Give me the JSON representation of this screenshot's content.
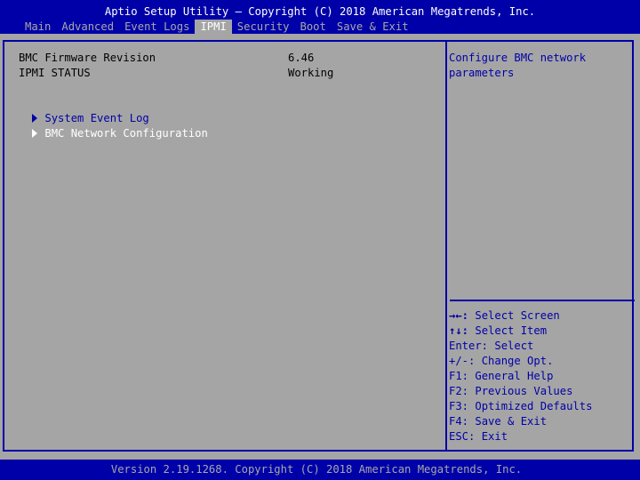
{
  "header": {
    "title": "Aptio Setup Utility – Copyright (C) 2018 American Megatrends, Inc.",
    "tabs": [
      {
        "label": "Main"
      },
      {
        "label": "Advanced"
      },
      {
        "label": "Event Logs"
      },
      {
        "label": "IPMI"
      },
      {
        "label": "Security"
      },
      {
        "label": "Boot"
      },
      {
        "label": "Save & Exit"
      }
    ],
    "active_tab": "IPMI"
  },
  "main": {
    "fields": [
      {
        "label": "BMC Firmware Revision",
        "value": "6.46"
      },
      {
        "label": "IPMI STATUS",
        "value": "Working"
      }
    ],
    "submenus": [
      {
        "label": "System Event Log"
      },
      {
        "label": "BMC Network Configuration"
      }
    ],
    "selected_submenu": "BMC Network Configuration"
  },
  "help": {
    "text": "Configure BMC network parameters",
    "keys": [
      {
        "key": "→←:",
        "desc": " Select Screen"
      },
      {
        "key": "↑↓:",
        "desc": " Select Item"
      },
      {
        "key": "Enter:",
        "desc": " Select"
      },
      {
        "key": "+/-:",
        "desc": " Change Opt."
      },
      {
        "key": "F1:",
        "desc": " General Help"
      },
      {
        "key": "F2:",
        "desc": " Previous Values"
      },
      {
        "key": "F3:",
        "desc": " Optimized Defaults"
      },
      {
        "key": "F4:",
        "desc": " Save & Exit"
      },
      {
        "key": "ESC:",
        "desc": " Exit"
      }
    ]
  },
  "footer": {
    "text": "Version 2.19.1268. Copyright (C) 2018 American Megatrends, Inc."
  },
  "colors": {
    "bar": "#0000a8",
    "panel": "#a5a5a5",
    "link": "#0000a8",
    "selected": "#ffffff"
  }
}
